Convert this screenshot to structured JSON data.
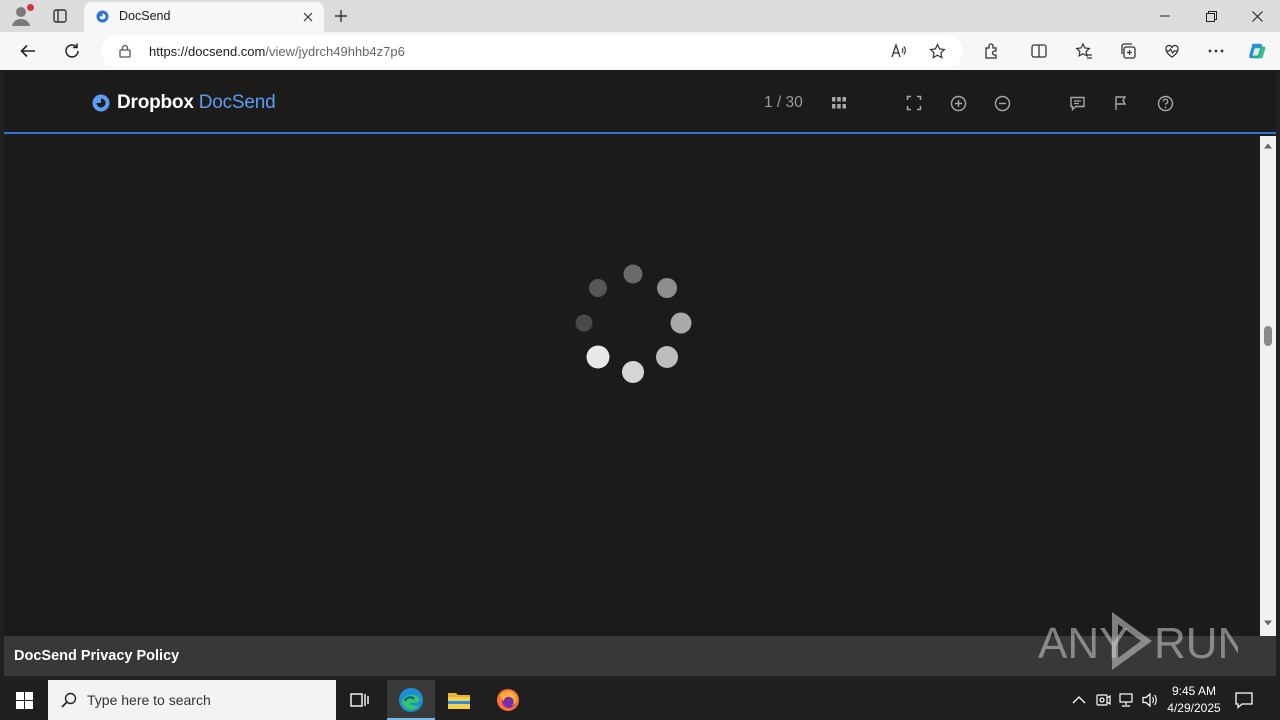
{
  "browser": {
    "tab_title": "DocSend",
    "url_host": "https://docsend.com",
    "url_path": "/view/jydrch49hhb4z7p6"
  },
  "viewer": {
    "brand_primary": "Dropbox",
    "brand_secondary": "DocSend",
    "page_count": "1 / 30",
    "state": "loading"
  },
  "footer": {
    "privacy_link": "DocSend Privacy Policy"
  },
  "watermark": {
    "text": "ANY RUN"
  },
  "taskbar": {
    "search_placeholder": "Type here to search",
    "time": "9:45 AM",
    "date": "4/29/2025"
  },
  "colors": {
    "accent_blue": "#2f74d9",
    "brand_blue": "#5b9cf5",
    "page_bg": "#1d1b1a",
    "footer_bg": "#3a3836"
  },
  "icons": {
    "header": [
      "grid-view-icon",
      "fullscreen-icon",
      "zoom-in-icon",
      "zoom-out-icon",
      "comment-icon",
      "flag-icon",
      "help-icon"
    ],
    "navbar": [
      "back-icon",
      "reload-icon",
      "read-aloud-icon",
      "favorite-star-icon",
      "extensions-icon",
      "split-screen-icon",
      "favorites-icon",
      "collections-icon",
      "browser-essentials-icon",
      "more-icon",
      "copilot-icon"
    ]
  }
}
